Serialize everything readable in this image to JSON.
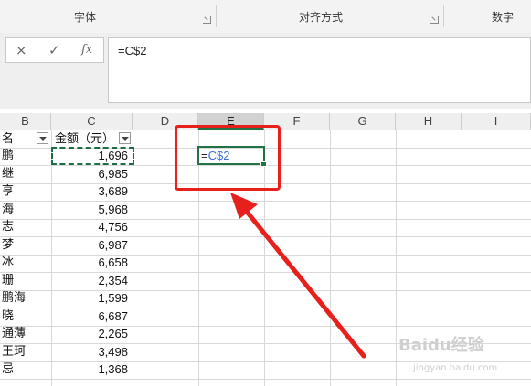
{
  "ribbon": {
    "groups": [
      {
        "label": "字体"
      },
      {
        "label": "对齐方式"
      },
      {
        "label": "数字"
      }
    ]
  },
  "formula_bar": {
    "cancel_icon": "×",
    "enter_icon": "✓",
    "function_icon": "fx",
    "formula": "=C$2"
  },
  "columns": [
    "B",
    "C",
    "D",
    "E",
    "F",
    "G",
    "H",
    "I"
  ],
  "selected_column": "E",
  "table": {
    "headers": {
      "b": "名",
      "c": "金额（元）"
    },
    "rows": [
      {
        "name": "鹏",
        "amount": "1,696"
      },
      {
        "name": "继",
        "amount": "6,985"
      },
      {
        "name": "亨",
        "amount": "3,689"
      },
      {
        "name": "海",
        "amount": "5,968"
      },
      {
        "name": "志",
        "amount": "4,756"
      },
      {
        "name": "梦",
        "amount": "6,987"
      },
      {
        "name": "冰",
        "amount": "6,658"
      },
      {
        "name": "珊",
        "amount": "2,354"
      },
      {
        "name": "鹏海",
        "amount": "1,599"
      },
      {
        "name": "晓",
        "amount": "6,687"
      },
      {
        "name": "通薄",
        "amount": "2,265"
      },
      {
        "name": "王珂",
        "amount": "3,498"
      },
      {
        "name": "忌",
        "amount": "1,368"
      }
    ]
  },
  "active_cell": {
    "eq": "=",
    "ref": "C$2"
  },
  "colors": {
    "selection": "#217346",
    "annotation": "#e8201c",
    "ref_blue": "#3b6fd3"
  },
  "watermark": {
    "main": "Baidu经验",
    "sub": "jingyan.baidu.com"
  }
}
